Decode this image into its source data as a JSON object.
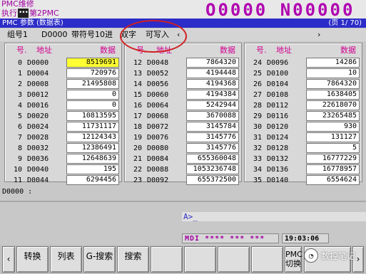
{
  "header": {
    "title": "PMC维修",
    "mode_run": "执行",
    "mode_dots": "•••",
    "mode_path": "第2PMC",
    "program_number": "O0000 N00000"
  },
  "titlebar": {
    "left": "PMC 参数 (数据表)",
    "page": "(页     1/ 70)"
  },
  "info": {
    "group": "组号1",
    "addr": "D0000",
    "format": "带符号10进",
    "size": "双字",
    "writable": "可写入",
    "arrow_left": "‹",
    "arrow_right": "›"
  },
  "columns": {
    "no": "号.",
    "addr": "地址",
    "data": "数据"
  },
  "panels": [
    {
      "rows": [
        {
          "no": "0",
          "addr": "D0000",
          "val": "8519691",
          "selected": true
        },
        {
          "no": "1",
          "addr": "D0004",
          "val": "720976"
        },
        {
          "no": "2",
          "addr": "D0008",
          "val": "21495808"
        },
        {
          "no": "3",
          "addr": "D0012",
          "val": "0"
        },
        {
          "no": "4",
          "addr": "D0016",
          "val": "0"
        },
        {
          "no": "5",
          "addr": "D0020",
          "val": "10813595"
        },
        {
          "no": "6",
          "addr": "D0024",
          "val": "11731117"
        },
        {
          "no": "7",
          "addr": "D0028",
          "val": "12124343"
        },
        {
          "no": "8",
          "addr": "D0032",
          "val": "12386491"
        },
        {
          "no": "9",
          "addr": "D0036",
          "val": "12648639"
        },
        {
          "no": "10",
          "addr": "D0040",
          "val": "195"
        },
        {
          "no": "11",
          "addr": "D0044",
          "val": "6294456"
        }
      ]
    },
    {
      "rows": [
        {
          "no": "12",
          "addr": "D0048",
          "val": "7864320"
        },
        {
          "no": "13",
          "addr": "D0052",
          "val": "4194448"
        },
        {
          "no": "14",
          "addr": "D0056",
          "val": "4194368"
        },
        {
          "no": "15",
          "addr": "D0060",
          "val": "4194384"
        },
        {
          "no": "16",
          "addr": "D0064",
          "val": "5242944"
        },
        {
          "no": "17",
          "addr": "D0068",
          "val": "3670088"
        },
        {
          "no": "18",
          "addr": "D0072",
          "val": "3145784"
        },
        {
          "no": "19",
          "addr": "D0076",
          "val": "3145776"
        },
        {
          "no": "20",
          "addr": "D0080",
          "val": "3145776"
        },
        {
          "no": "21",
          "addr": "D0084",
          "val": "655360048"
        },
        {
          "no": "22",
          "addr": "D0088",
          "val": "1053236748"
        },
        {
          "no": "23",
          "addr": "D0092",
          "val": "655372500"
        }
      ]
    },
    {
      "rows": [
        {
          "no": "24",
          "addr": "D0096",
          "val": "14286"
        },
        {
          "no": "25",
          "addr": "D0100",
          "val": "10"
        },
        {
          "no": "26",
          "addr": "D0104",
          "val": "7864320"
        },
        {
          "no": "27",
          "addr": "D0108",
          "val": "1638405"
        },
        {
          "no": "28",
          "addr": "D0112",
          "val": "22618070"
        },
        {
          "no": "29",
          "addr": "D0116",
          "val": "23265485"
        },
        {
          "no": "30",
          "addr": "D0120",
          "val": "930"
        },
        {
          "no": "31",
          "addr": "D0124",
          "val": "131127"
        },
        {
          "no": "32",
          "addr": "D0128",
          "val": "5"
        },
        {
          "no": "33",
          "addr": "D0132",
          "val": "16777229"
        },
        {
          "no": "34",
          "addr": "D0136",
          "val": "16778957"
        },
        {
          "no": "35",
          "addr": "D0140",
          "val": "6554624"
        }
      ]
    }
  ],
  "command_line": "D0000 :",
  "input_prompt": "A>_",
  "status": {
    "mode": "MDI  **** *** ***",
    "time": "19:03:06"
  },
  "softkeys": {
    "prev": "‹",
    "k1": "转换",
    "k2": "列表",
    "k3": "G-搜索",
    "k4": "搜索",
    "k9": "PMC切换",
    "next": "›"
  },
  "watermark": {
    "text": "数控笔记",
    "icon": "chat-icon"
  },
  "colors": {
    "titlebar": "#2c2cc8",
    "selected_cell": "#ffff33",
    "program_number": "#b000b0",
    "highlight_circle": "#d02020"
  }
}
